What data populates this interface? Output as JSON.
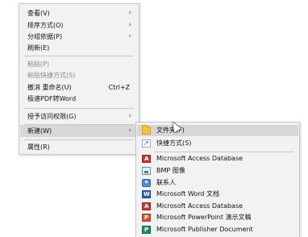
{
  "main_menu": {
    "items": [
      {
        "label": "查看(V)",
        "submenu": true,
        "disabled": false
      },
      {
        "label": "排序方式(O)",
        "submenu": true,
        "disabled": false
      },
      {
        "label": "分组依据(P)",
        "submenu": true,
        "disabled": false
      },
      {
        "label": "刷新(E)",
        "submenu": false,
        "disabled": false
      },
      {
        "label": "粘贴(P)",
        "submenu": false,
        "disabled": true
      },
      {
        "label": "粘贴快捷方式(S)",
        "submenu": false,
        "disabled": true
      },
      {
        "label": "撤消 重命名(U)",
        "shortcut": "Ctrl+Z",
        "submenu": false,
        "disabled": false
      },
      {
        "label": "极速PDF转Word",
        "submenu": false,
        "disabled": false
      },
      {
        "label": "授予访问权限(G)",
        "submenu": true,
        "disabled": false
      },
      {
        "label": "新建(W)",
        "submenu": true,
        "disabled": false,
        "highlighted": true
      },
      {
        "label": "属性(R)",
        "submenu": false,
        "disabled": false
      }
    ]
  },
  "new_submenu": {
    "items": [
      {
        "label": "文件夹(F)",
        "icon": "folder-icon",
        "highlighted": true
      },
      {
        "label": "快捷方式(S)",
        "icon": "shortcut-icon"
      },
      {
        "label": "Microsoft Access Database",
        "icon": "access-icon"
      },
      {
        "label": "BMP 图像",
        "icon": "bmp-icon"
      },
      {
        "label": "联系人",
        "icon": "contact-icon"
      },
      {
        "label": "Microsoft Word 文档",
        "icon": "word-icon"
      },
      {
        "label": "Microsoft Access Database",
        "icon": "access-icon"
      },
      {
        "label": "Microsoft PowerPoint 演示文稿",
        "icon": "powerpoint-icon"
      },
      {
        "label": "Microsoft Publisher Document",
        "icon": "publisher-icon"
      }
    ]
  },
  "icons": {
    "submenu_arrow": "chevron-right-icon"
  },
  "colors": {
    "menu_bg": "#f2f2f2",
    "highlight": "#d7d7d7",
    "disabled_text": "#8a8a8a"
  }
}
